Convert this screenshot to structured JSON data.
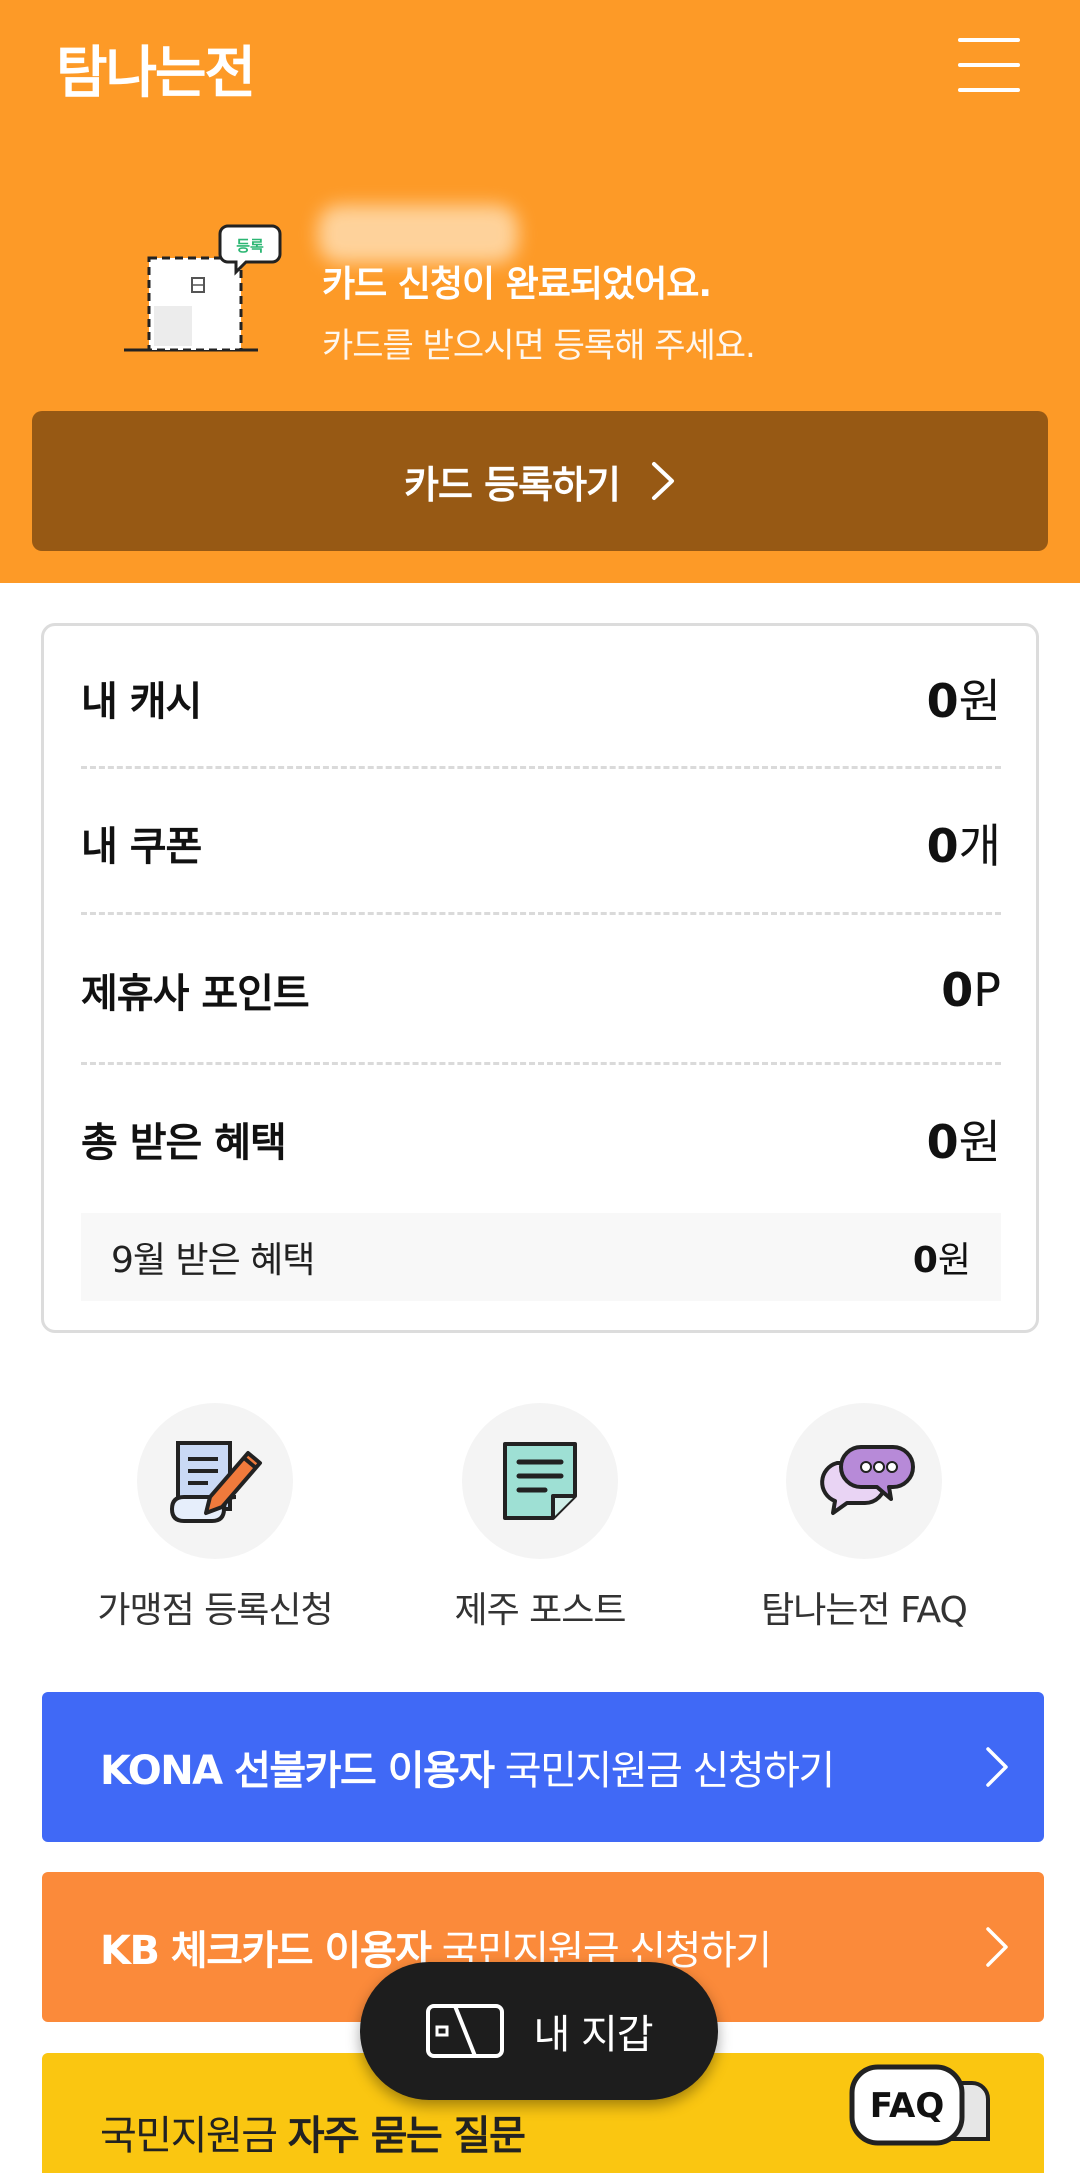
{
  "header": {
    "brand": "탐나는전",
    "menu_icon": "hamburger-menu-icon"
  },
  "hero": {
    "illustration_tag": "등록",
    "message_line1": "카드 신청이 완료되었어요.",
    "message_line2": "카드를 받으시면 등록해 주세요.",
    "register_button": "카드 등록하기",
    "bg_color": "#fd9a27",
    "button_color": "#975914"
  },
  "wallet": {
    "rows": [
      {
        "label": "내 캐시",
        "amount": "0",
        "unit": "원"
      },
      {
        "label": "내 쿠폰",
        "amount": "0",
        "unit": "개"
      },
      {
        "label": "제휴사 포인트",
        "amount": "0",
        "unit": "P"
      },
      {
        "label": "총 받은 혜택",
        "amount": "0",
        "unit": "원"
      }
    ],
    "monthly": {
      "label": "9월 받은 혜택",
      "amount": "0",
      "unit": "원"
    }
  },
  "quick_menu": [
    {
      "label": "가맹점 등록신청",
      "icon": "document-pencil-icon"
    },
    {
      "label": "제주 포스트",
      "icon": "note-icon"
    },
    {
      "label": "탐나는전 FAQ",
      "icon": "chat-bubbles-icon"
    }
  ],
  "banners": {
    "blue": {
      "bold": "KONA 선불카드 이용자",
      "normal": " 국민지원금 신청하기",
      "color": "#4069f6"
    },
    "orange": {
      "bold": "KB 체크카드 이용자",
      "normal": " 국민지원금 신청하기",
      "color": "#fb8a3a"
    },
    "yellow": {
      "normal": "국민지원금 ",
      "bold": "자주 묻는 질문",
      "badge": "FAQ",
      "color": "#fac611"
    }
  },
  "fab": {
    "label": "내 지갑",
    "icon": "wallet-card-icon"
  }
}
